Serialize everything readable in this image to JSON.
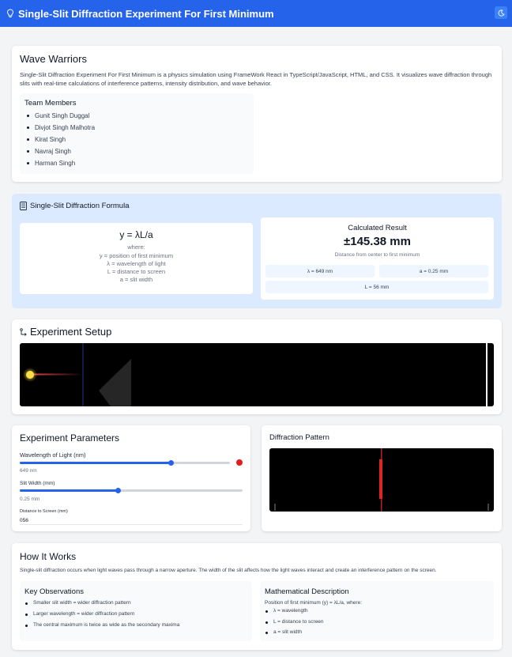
{
  "app": {
    "title": "Single-Slit Diffraction Experiment For First Minimum",
    "theme_toggle_icon": "moon-icon",
    "brand_icon": "lightbulb-icon",
    "accent_color": "#2563eb"
  },
  "team": {
    "heading": "Wave Warriors",
    "description": "Single-Slit Diffraction Experiment For First Minimum is a physics simulation using FrameWork React in TypeScript/JavaScript, HTML, and CSS. It visualizes wave diffraction through slits with real-time calculations of interference patterns, intensity distribution, and wave behavior.",
    "members_heading": "Team Members",
    "members": [
      "Gunit Singh Duggal",
      "Divjot Singh Malhotra",
      "Kirat Singh",
      "Navraj Singh",
      "Harman Singh"
    ]
  },
  "formula": {
    "heading": "Single-Slit Diffraction Formula",
    "icon": "calculator-icon",
    "equation": "y = λL/a",
    "where_label": "where:",
    "definitions": [
      "y = position of first minimum",
      "λ = wavelength of light",
      "L = distance to screen",
      "a = slit width"
    ],
    "result_heading": "Calculated Result",
    "result_value": "±145.38 mm",
    "result_caption": "Distance from center to first minimum",
    "chips": {
      "wavelength": "λ = 649 nm",
      "slit": "a = 0.25 mm",
      "distance": "L = 56 mm"
    }
  },
  "setup": {
    "heading": "Experiment Setup",
    "icon": "setup-icon"
  },
  "parameters": {
    "heading": "Experiment Parameters",
    "wavelength_label": "Wavelength of Light (nm)",
    "wavelength_value": "649 nm",
    "wavelength_fraction": 0.72,
    "wavelength_color": "#e11d1d",
    "slit_label": "Slit Width (mm)",
    "slit_value": "0.25 mm",
    "slit_fraction": 0.44,
    "distance_label": "Distance to Screen (mm)",
    "distance_input": "056"
  },
  "pattern": {
    "heading": "Diffraction Pattern"
  },
  "how": {
    "heading": "How It Works",
    "intro": "Single-slit diffraction occurs when light waves pass through a narrow aperture. The width of the slit affects how the light waves interact and create an interference pattern on the screen.",
    "observations_heading": "Key Observations",
    "observations": [
      "Smaller slit width = wider diffraction pattern",
      "Larger wavelength = wider diffraction pattern",
      "The central maximum is twice as wide as the secondary maxima"
    ],
    "math_heading": "Mathematical Description",
    "math_intro": "Position of first minimum (y) = λL/a, where:",
    "math_items": [
      "λ = wavelength",
      "L = distance to screen",
      "a = slit width"
    ]
  }
}
